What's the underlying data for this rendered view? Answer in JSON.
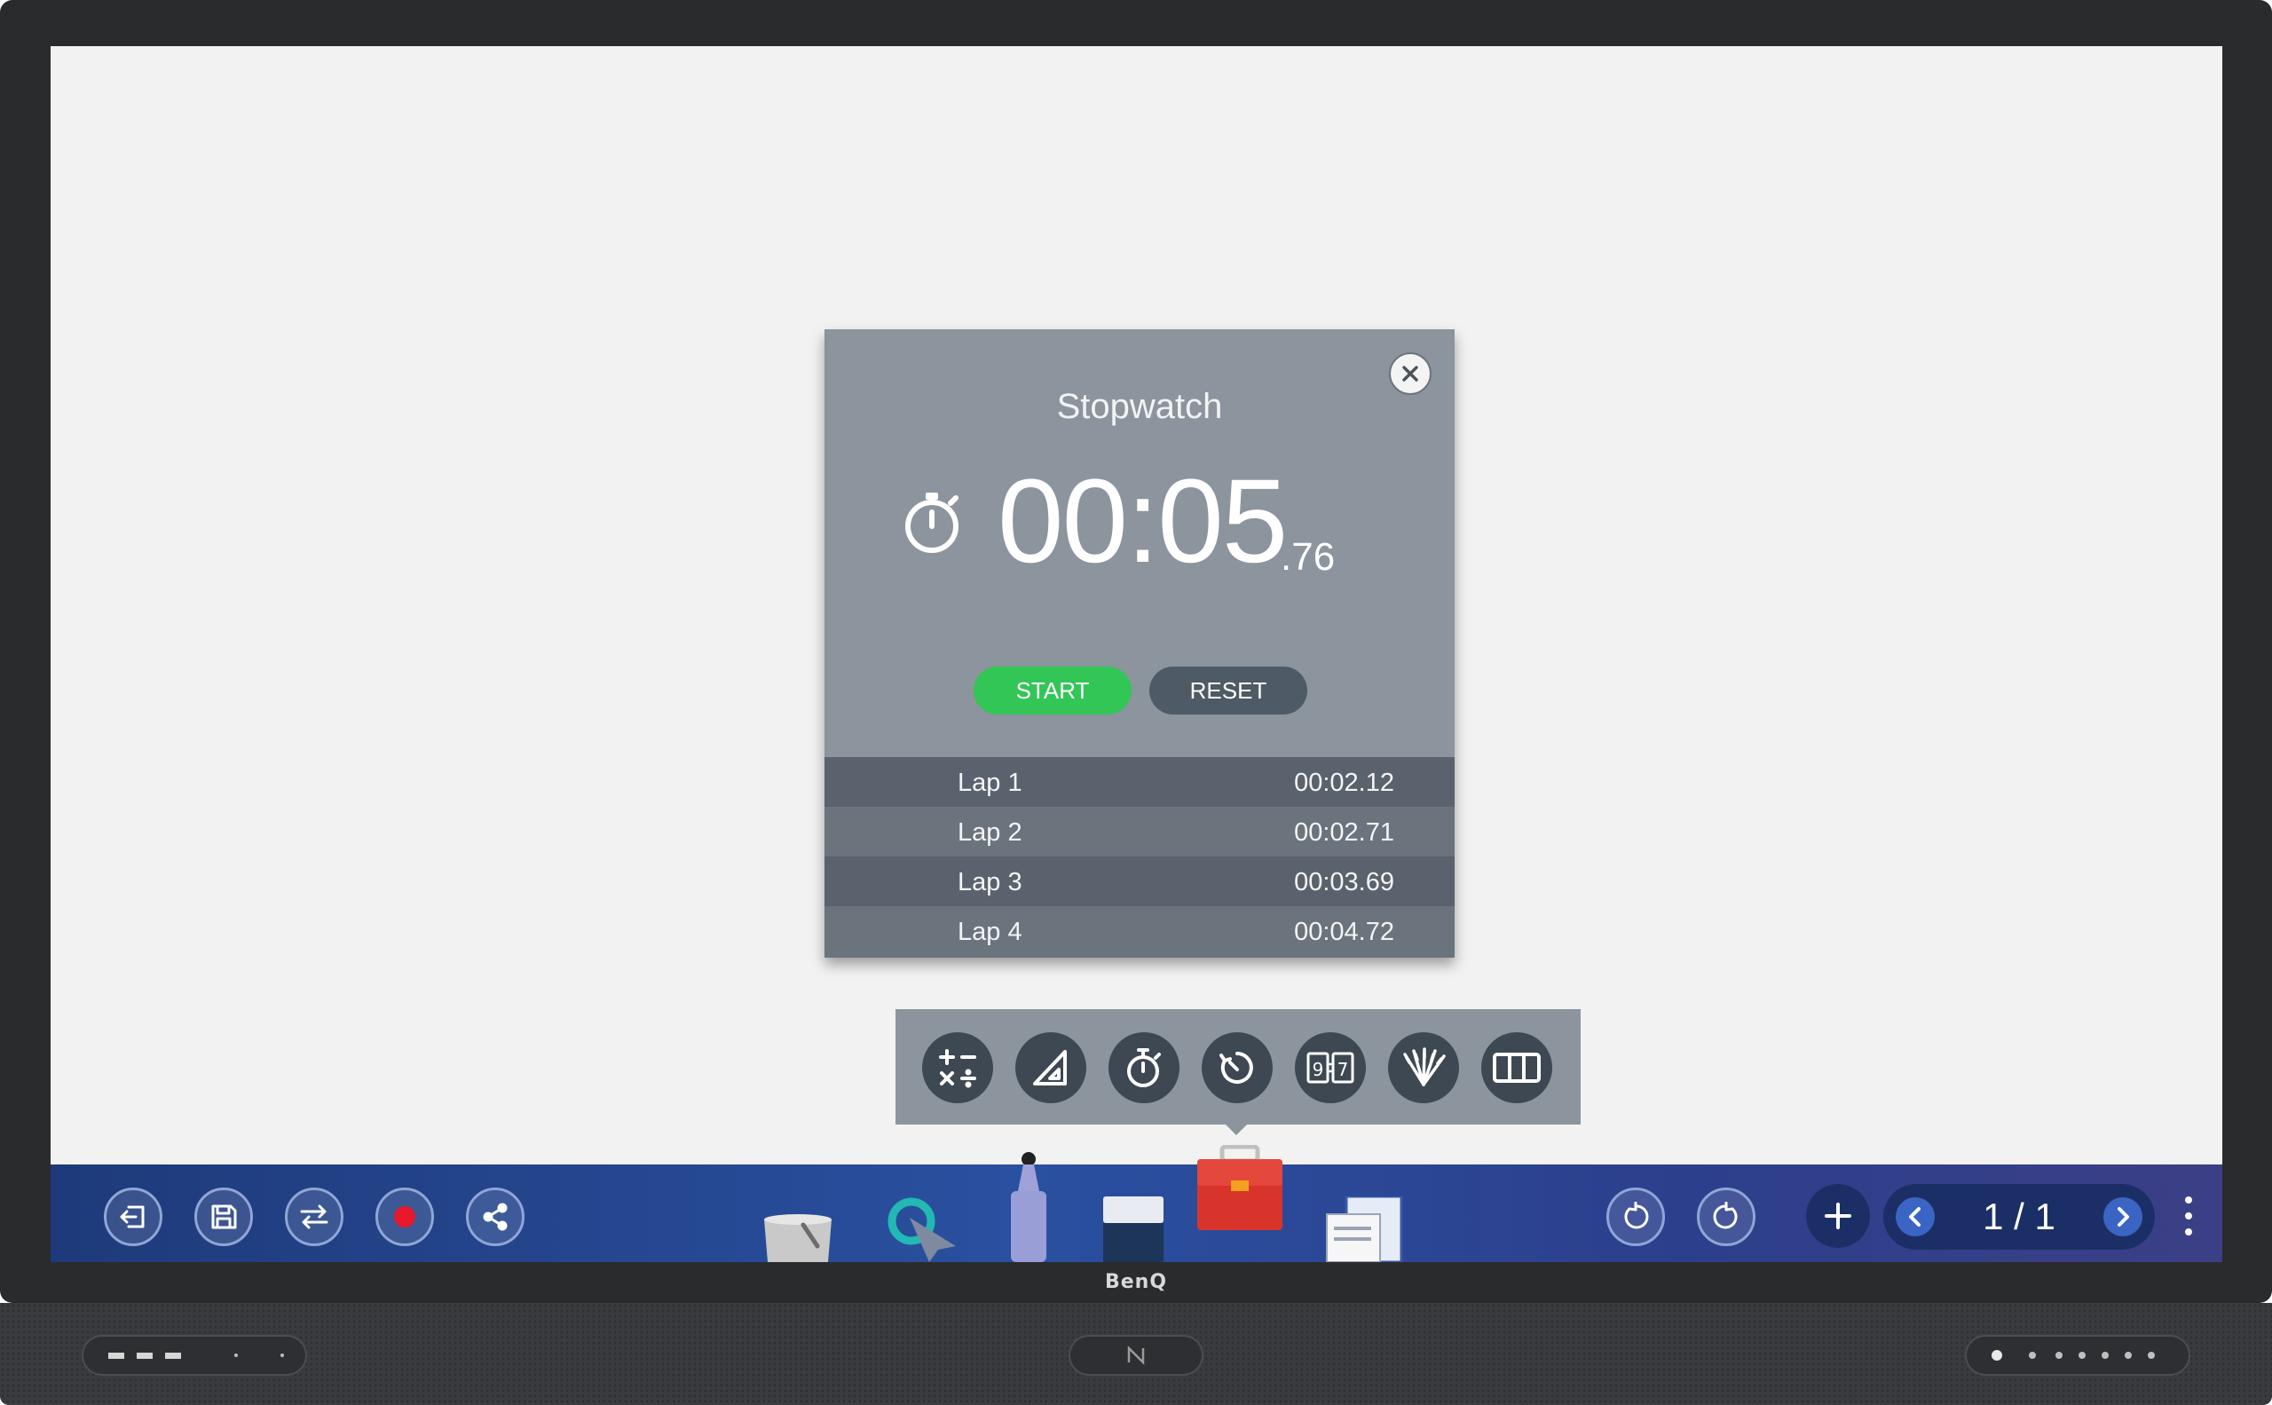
{
  "brand": "BenQ",
  "stopwatch": {
    "title": "Stopwatch",
    "time_main": "00:05",
    "time_fraction": ".76",
    "start_label": "START",
    "reset_label": "RESET",
    "laps": [
      {
        "name": "Lap 1",
        "time": "00:02.12"
      },
      {
        "name": "Lap 2",
        "time": "00:02.71"
      },
      {
        "name": "Lap 3",
        "time": "00:03.69"
      },
      {
        "name": "Lap 4",
        "time": "00:04.72"
      }
    ]
  },
  "tools": [
    "calculator-icon",
    "ruler-triangle-icon",
    "stopwatch-icon",
    "timer-icon",
    "flip-clock-icon",
    "lottery-sticks-icon",
    "columns-icon"
  ],
  "pager": {
    "label": "1 / 1"
  },
  "colors": {
    "start": "#32c657",
    "reset": "#4e5a65",
    "taskbar": "#2a50a0",
    "record": "#e8192c",
    "toolbox": "#d9342b"
  }
}
